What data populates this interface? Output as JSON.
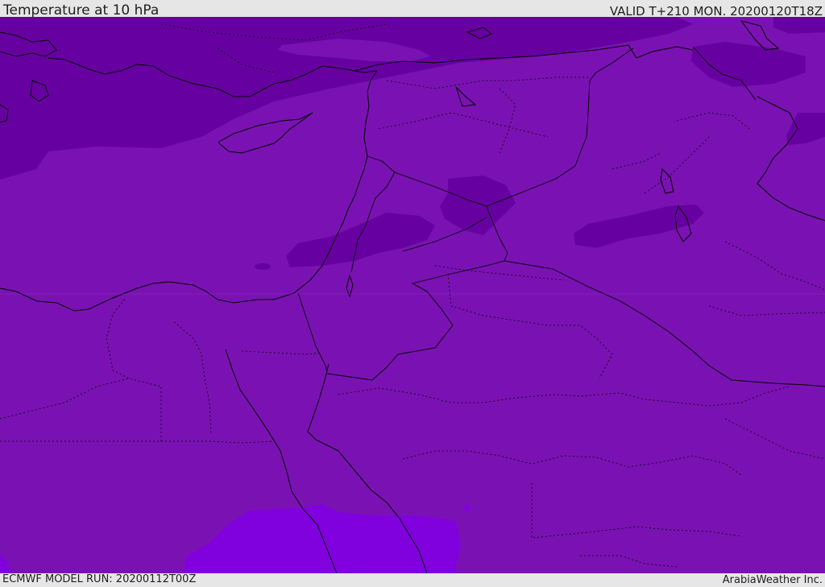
{
  "header": {
    "title": "Temperature at 10 hPa",
    "valid_time": "VALID T+210 MON. 20200120T18Z"
  },
  "footer": {
    "model_run": "ECMWF MODEL RUN: 20200112T00Z",
    "credit": "ArabiaWeather Inc."
  },
  "map": {
    "colors": {
      "base": "#7a12b3",
      "dark": "#6700a1",
      "bright": "#8000de",
      "border": "#000000"
    }
  }
}
